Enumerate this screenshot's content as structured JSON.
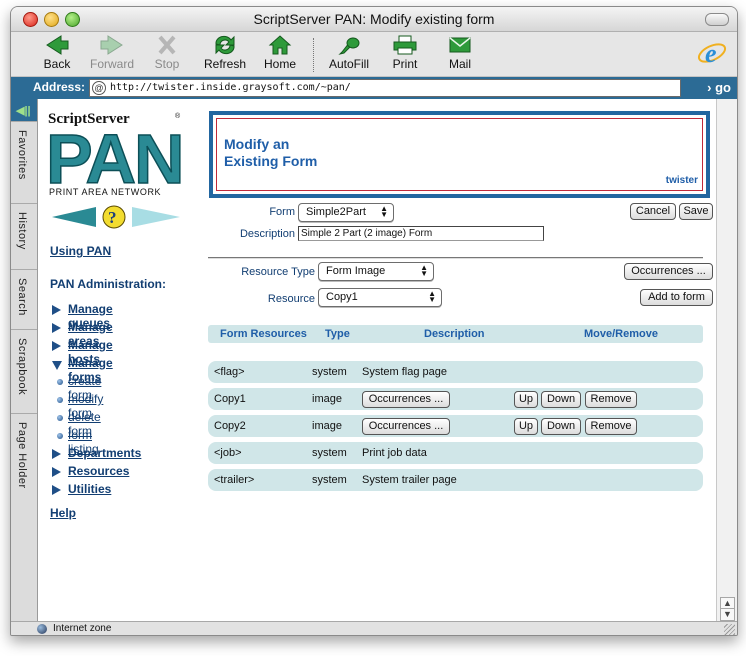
{
  "window": {
    "title": "ScriptServer PAN: Modify existing form"
  },
  "toolbar": {
    "back": "Back",
    "forward": "Forward",
    "stop": "Stop",
    "refresh": "Refresh",
    "home": "Home",
    "autofill": "AutoFill",
    "print": "Print",
    "mail": "Mail"
  },
  "address": {
    "label": "Address:",
    "url": "http://twister.inside.graysoft.com/~pan/",
    "go": "go"
  },
  "sidetabs": [
    "Favorites",
    "History",
    "Search",
    "Scrapbook",
    "Page Holder"
  ],
  "logo": {
    "brand": "ScriptServer",
    "reg": "®",
    "big": "PAN",
    "sub": "PRINT AREA NETWORK"
  },
  "nav": {
    "using": "Using PAN",
    "admin_heading": "PAN Administration:",
    "items": {
      "queues": "Manage queues",
      "areas": "Manage areas",
      "hosts": "Manage hosts",
      "forms": "Manage forms",
      "departments": "Departments",
      "resources": "Resources",
      "utilities": "Utilities"
    },
    "sub": {
      "create": "create form",
      "modify": "modify form",
      "delete": "delete form",
      "listing": "form listing"
    },
    "help": "Help"
  },
  "header": {
    "title_line1": "Modify an",
    "title_line2": "Existing Form",
    "host": "twister"
  },
  "form": {
    "form_label": "Form",
    "form_value": "Simple2Part",
    "desc_label": "Description",
    "desc_value": "Simple 2 Part (2 image) Form",
    "cancel": "Cancel",
    "save": "Save",
    "rtype_label": "Resource Type",
    "rtype_value": "Form Image",
    "occurrences": "Occurrences ...",
    "resource_label": "Resource",
    "resource_value": "Copy1",
    "add": "Add to form"
  },
  "table": {
    "headers": {
      "resources": "Form Resources",
      "type": "Type",
      "description": "Description",
      "move": "Move/Remove"
    },
    "rows": [
      {
        "name": "<flag>",
        "type": "system",
        "desc": "System flag page"
      },
      {
        "name": "Copy1",
        "type": "image",
        "occ": "Occurrences ...",
        "up": "Up",
        "down": "Down",
        "remove": "Remove"
      },
      {
        "name": "Copy2",
        "type": "image",
        "occ": "Occurrences ...",
        "up": "Up",
        "down": "Down",
        "remove": "Remove"
      },
      {
        "name": "<job>",
        "type": "system",
        "desc": "Print job data"
      },
      {
        "name": "<trailer>",
        "type": "system",
        "desc": "System trailer page"
      }
    ]
  },
  "status": {
    "zone": "Internet zone"
  },
  "colors": {
    "accent": "#2c6b95",
    "link": "#123e72",
    "row": "#d0e6e8",
    "header_border": "#2266a0"
  }
}
